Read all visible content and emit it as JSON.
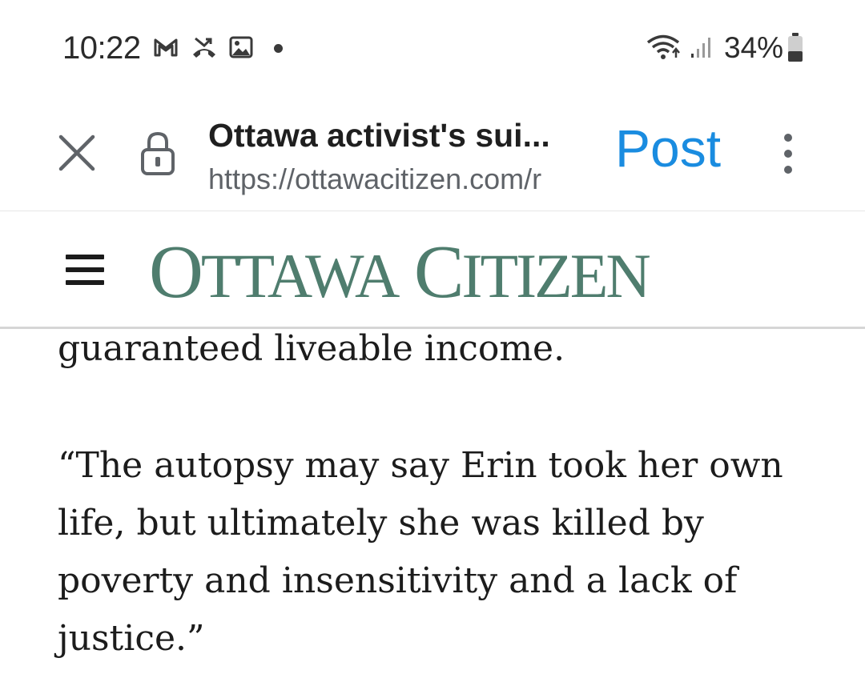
{
  "status_bar": {
    "time": "10:22",
    "notification_icons": [
      "gmail-icon",
      "missed-call-icon",
      "gallery-icon"
    ],
    "wifi": "wifi-icon",
    "signal": "signal-icon",
    "battery_percent": "34%"
  },
  "toolbar": {
    "page_title": "Ottawa activist's sui...",
    "url": "https://ottawacitizen.com/r",
    "action_label": "Post",
    "close_icon": "close-icon",
    "lock_icon": "lock-icon",
    "menu_icon": "more-vert-icon"
  },
  "site": {
    "logo_word1_initial": "O",
    "logo_word1_rest": "TTAWA",
    "logo_word2_initial": "C",
    "logo_word2_rest": "ITIZEN",
    "logo_color": "#4f7d6e",
    "menu_icon": "hamburger-icon"
  },
  "article": {
    "paragraphs": [
      "guaranteed liveable income.",
      "“The autopsy may say Erin took her own life, but ultimately she was killed by poverty and insensitivity and a lack of justice.”"
    ]
  },
  "colors": {
    "accent": "#1a8ce0",
    "logo": "#4f7d6e"
  }
}
